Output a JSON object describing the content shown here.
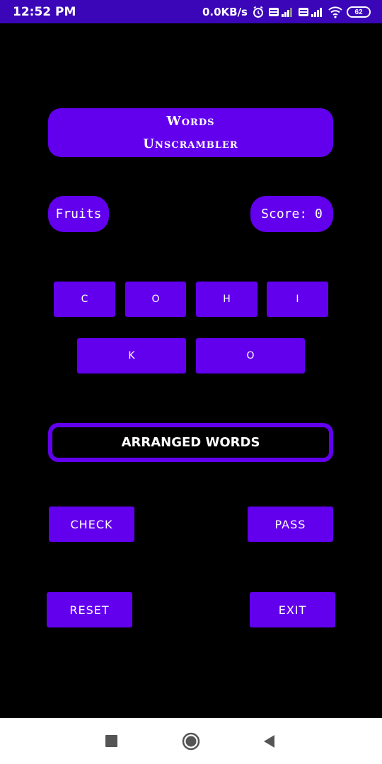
{
  "status_bar": {
    "time": "12:52 PM",
    "net_speed": "0.0KB/s",
    "battery": "62",
    "icons": [
      "alarm-icon",
      "volte-signal-icon",
      "volte-signal-icon",
      "wifi-icon",
      "battery-icon"
    ]
  },
  "title": {
    "line1": "Words",
    "line2": "Unscrambler"
  },
  "category": "Fruits",
  "score": "Score: 0",
  "letters": [
    "C",
    "O",
    "H",
    "I",
    "K",
    "O"
  ],
  "answer_field": "ARRANGED WORDS",
  "buttons": {
    "check": "CHECK",
    "pass": "PASS",
    "reset": "RESET",
    "exit": "EXIT"
  },
  "nav_bar": {
    "icons": [
      "recents-square-icon",
      "home-circle-icon",
      "back-triangle-icon"
    ]
  },
  "colors": {
    "accent": "#6200ee",
    "status_bar": "#3a06b8",
    "background": "#000000",
    "nav_bar": "#ffffff"
  }
}
